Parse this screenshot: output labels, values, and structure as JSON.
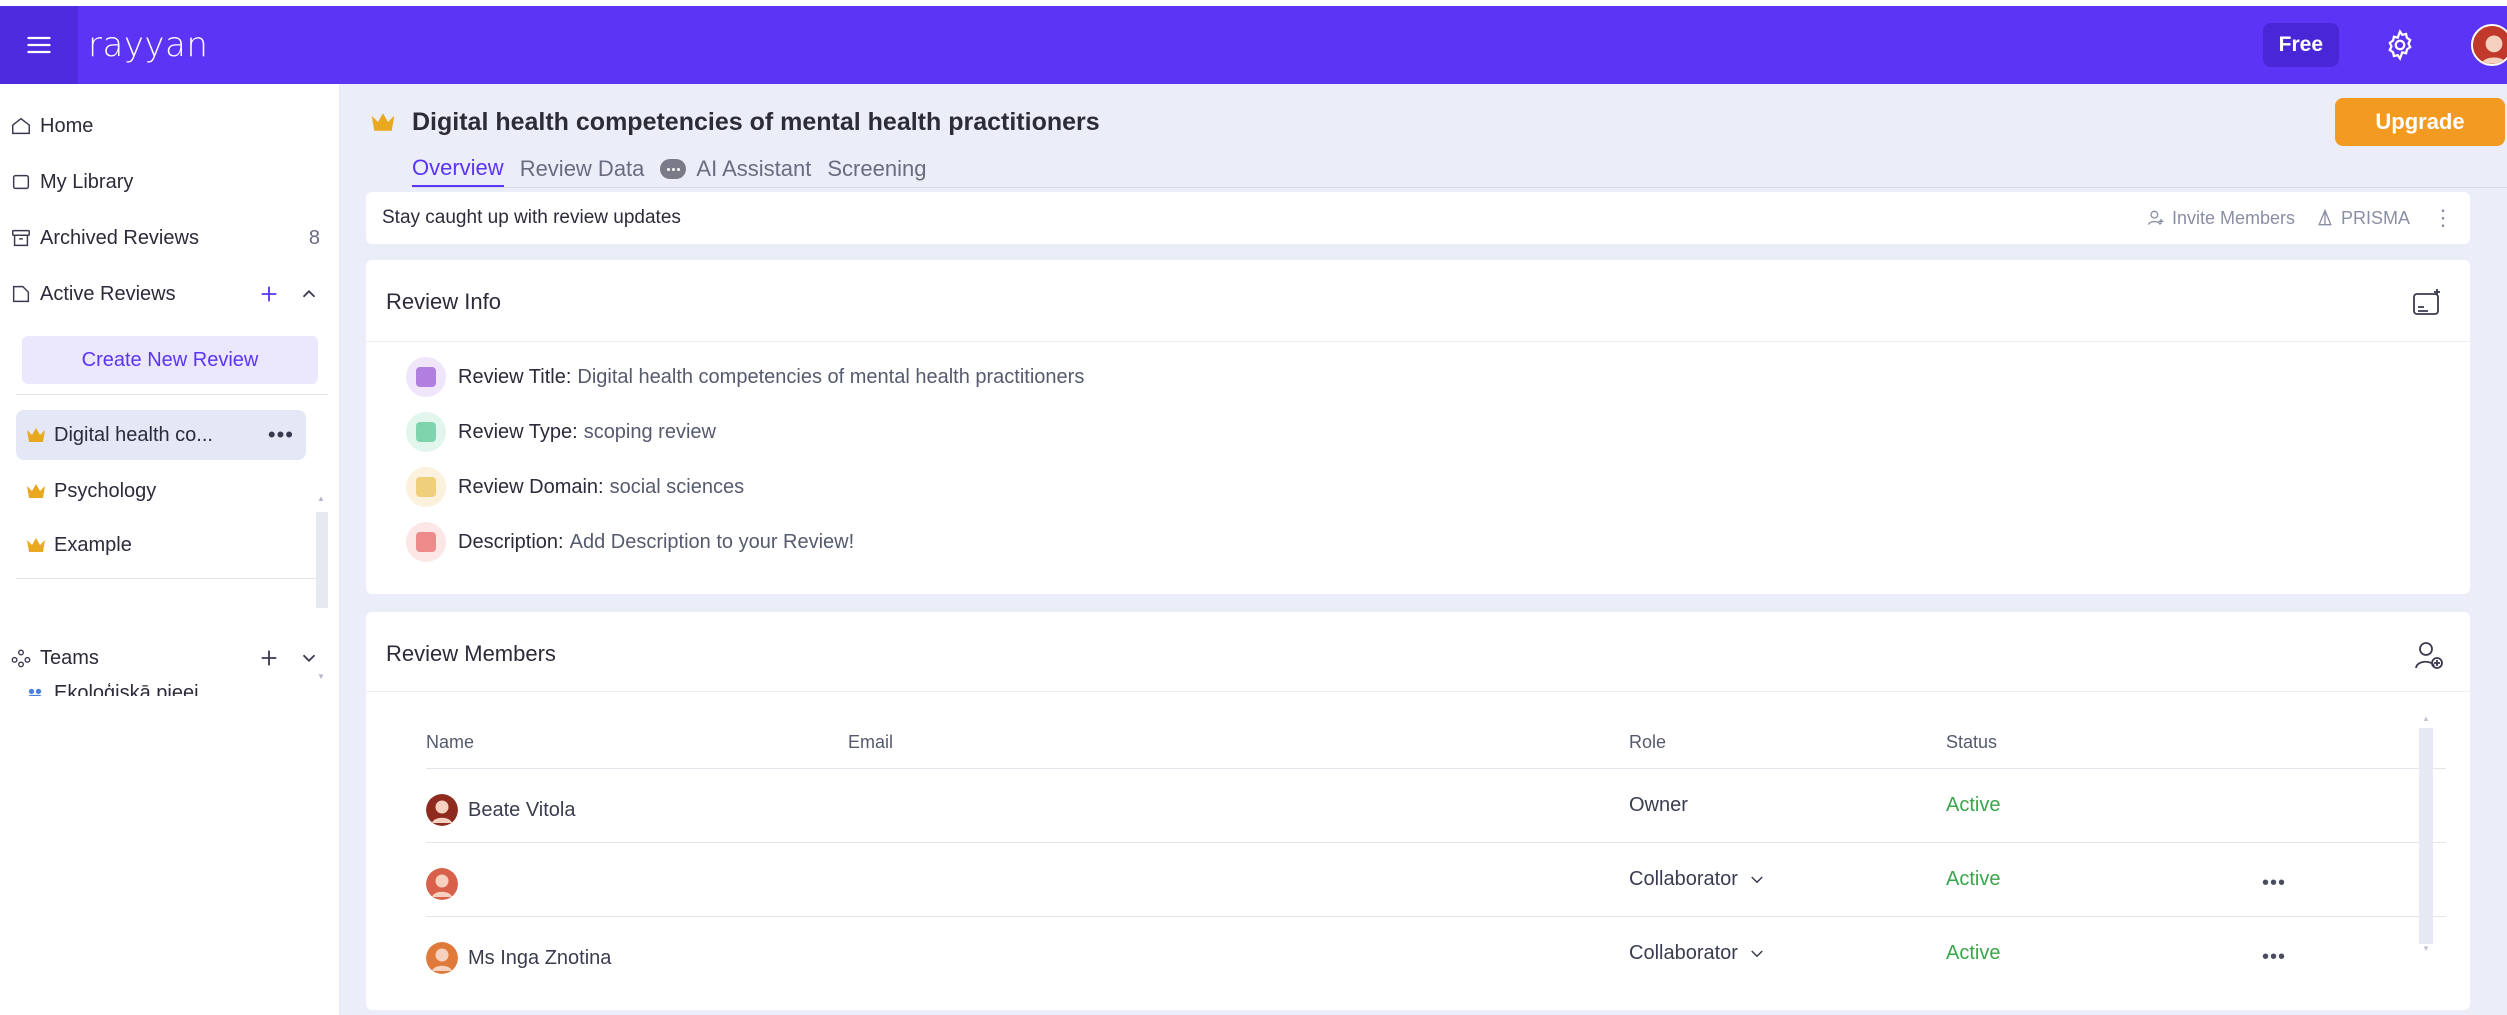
{
  "app": {
    "brand": "rayyan",
    "plan_badge": "Free"
  },
  "sidebar": {
    "home": "Home",
    "library": "My Library",
    "archived": {
      "label": "Archived Reviews",
      "count": "8"
    },
    "active": {
      "label": "Active Reviews"
    },
    "create_button": "Create New Review",
    "reviews": [
      {
        "label": "Digital health co..."
      },
      {
        "label": "Psychology"
      },
      {
        "label": "Example"
      }
    ],
    "partial_item": "Ekoloģiskā pieej",
    "teams": "Teams"
  },
  "page": {
    "title": "Digital health competencies of mental health practitioners",
    "upgrade": "Upgrade",
    "tabs": [
      "Overview",
      "Review Data",
      "AI Assistant",
      "Screening"
    ]
  },
  "updates": {
    "text": "Stay caught up with review updates",
    "invite": "Invite Members",
    "prisma": "PRISMA"
  },
  "review_info": {
    "title": "Review Info",
    "rows": [
      {
        "label": "Review Title:",
        "value": "Digital health competencies of mental health practitioners"
      },
      {
        "label": "Review Type:",
        "value": "scoping review"
      },
      {
        "label": "Review Domain:",
        "value": "social sciences"
      },
      {
        "label": "Description:",
        "value": "Add Description to your Review!"
      }
    ]
  },
  "members": {
    "title": "Review Members",
    "columns": {
      "name": "Name",
      "email": "Email",
      "role": "Role",
      "status": "Status"
    },
    "rows": [
      {
        "name": "Beate Vitola",
        "email": "",
        "role": "Owner",
        "status": "Active"
      },
      {
        "name": "",
        "email": "",
        "role": "Collaborator",
        "status": "Active"
      },
      {
        "name": "Ms Inga Znotina",
        "email": "",
        "role": "Collaborator",
        "status": "Active"
      }
    ]
  },
  "colors": {
    "brand": "#5b34f5",
    "upgrade": "#f29a22",
    "active_status": "#3aa64b",
    "crown": "#e8a820"
  }
}
